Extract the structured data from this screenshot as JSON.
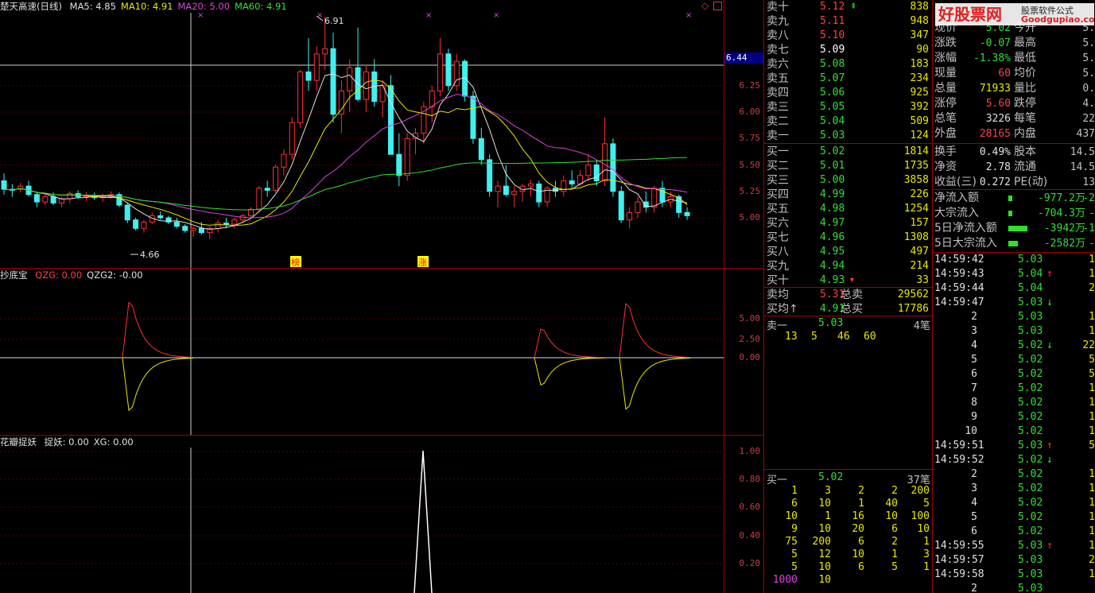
{
  "main_chart": {
    "stock_name": "楚天高速(日线)",
    "ma_labels": [
      {
        "text": "MA5: 4.85",
        "color": "#e0e0e0"
      },
      {
        "text": "MA10: 4.91",
        "color": "#e8e800"
      },
      {
        "text": "MA20: 5.00",
        "color": "#e040e0"
      },
      {
        "text": "MA60: 4.91",
        "color": "#30e030"
      }
    ],
    "crosshair_price": "6.44",
    "high_marker": "6.91",
    "low_marker": "4.66",
    "axis_ticks": [
      "6.25",
      "6.00",
      "5.75",
      "5.50",
      "5.25",
      "5.00"
    ],
    "tags": [
      "榜",
      "涨"
    ]
  },
  "indicator1": {
    "name": "抄底宝",
    "labels": [
      {
        "text": "QZG: 0.00",
        "color": "#ff4040"
      },
      {
        "text": "QZG2: -0.00",
        "color": "#e0e0e0"
      }
    ],
    "axis_ticks": [
      "5.00",
      "2.50",
      "0.00"
    ]
  },
  "indicator2": {
    "name": "花瓣捉妖",
    "labels": [
      {
        "text": "捉妖: 0.00",
        "color": "#e0e0e0"
      },
      {
        "text": "XG: 0.00",
        "color": "#e0e0e0"
      }
    ],
    "axis_ticks": [
      "1.00",
      "0.80",
      "0.60",
      "0.40",
      "0.20"
    ]
  },
  "watermark": {
    "brand": "好股票网",
    "sub": "股票软件公式",
    "url": "Goodgupiao.com"
  },
  "order_book": {
    "asks": [
      {
        "label": "卖十",
        "price": "5.12",
        "volume": "838",
        "color": "#ff4040",
        "mark": "⇞"
      },
      {
        "label": "卖九",
        "price": "5.11",
        "volume": "948",
        "color": "#ff4040",
        "mark": ""
      },
      {
        "label": "卖八",
        "price": "5.10",
        "volume": "347",
        "color": "#ff4040",
        "mark": ""
      },
      {
        "label": "卖七",
        "price": "5.09",
        "volume": "90",
        "color": "#ffffff",
        "mark": ""
      },
      {
        "label": "卖六",
        "price": "5.08",
        "volume": "183",
        "color": "#30e030",
        "mark": ""
      },
      {
        "label": "卖五",
        "price": "5.07",
        "volume": "234",
        "color": "#30e030",
        "mark": ""
      },
      {
        "label": "卖四",
        "price": "5.06",
        "volume": "925",
        "color": "#30e030",
        "mark": ""
      },
      {
        "label": "卖三",
        "price": "5.05",
        "volume": "392",
        "color": "#30e030",
        "mark": ""
      },
      {
        "label": "卖二",
        "price": "5.04",
        "volume": "509",
        "color": "#30e030",
        "mark": ""
      },
      {
        "label": "卖一",
        "price": "5.03",
        "volume": "124",
        "color": "#30e030",
        "mark": ""
      }
    ],
    "bids": [
      {
        "label": "买一",
        "price": "5.02",
        "volume": "1814",
        "color": "#30e030",
        "mark": ""
      },
      {
        "label": "买二",
        "price": "5.01",
        "volume": "1735",
        "color": "#30e030",
        "mark": ""
      },
      {
        "label": "买三",
        "price": "5.00",
        "volume": "3858",
        "color": "#30e030",
        "mark": ""
      },
      {
        "label": "买四",
        "price": "4.99",
        "volume": "226",
        "color": "#30e030",
        "mark": ""
      },
      {
        "label": "买五",
        "price": "4.98",
        "volume": "1254",
        "color": "#30e030",
        "mark": ""
      },
      {
        "label": "买六",
        "price": "4.97",
        "volume": "157",
        "color": "#30e030",
        "mark": ""
      },
      {
        "label": "买七",
        "price": "4.96",
        "volume": "1308",
        "color": "#30e030",
        "mark": ""
      },
      {
        "label": "买八",
        "price": "4.95",
        "volume": "497",
        "color": "#30e030",
        "mark": ""
      },
      {
        "label": "买九",
        "price": "4.94",
        "volume": "214",
        "color": "#30e030",
        "mark": ""
      },
      {
        "label": "买十",
        "price": "4.93",
        "volume": "33",
        "color": "#30e030",
        "mark": "▾"
      }
    ],
    "summary": [
      {
        "label": "卖均",
        "price": "5.31",
        "price_color": "#ff4040",
        "label2": "总卖",
        "value": "29562"
      },
      {
        "label": "买均↑",
        "price": "4.91",
        "price_color": "#30e030",
        "label2": "总买",
        "value": "17786"
      }
    ],
    "sell1_queue": {
      "label": "卖一",
      "price": "5.03",
      "count": "4笔",
      "orders": [
        "13",
        "5",
        "46",
        "60"
      ]
    },
    "buy1_queue": {
      "label": "买一",
      "price": "5.02",
      "count": "37笔",
      "rows": [
        [
          "1",
          "3",
          "2",
          "2",
          "200"
        ],
        [
          "6",
          "10",
          "1",
          "40",
          "5"
        ],
        [
          "10",
          "1",
          "16",
          "10",
          "100"
        ],
        [
          "9",
          "10",
          "20",
          "6",
          "10"
        ],
        [
          "75",
          "200",
          "6",
          "2",
          "1"
        ],
        [
          "5",
          "12",
          "10",
          "1",
          "3"
        ],
        [
          "5",
          "10",
          "6",
          "5",
          "1"
        ],
        [
          "1000",
          "10",
          "",
          "",
          ""
        ]
      ]
    }
  },
  "quote": [
    {
      "l1": "现价",
      "v1": "5.02",
      "c1": "#30e030",
      "l2": "今开",
      "v2": "5."
    },
    {
      "l1": "涨跌",
      "v1": "-0.07",
      "c1": "#30e030",
      "l2": "最高",
      "v2": "5."
    },
    {
      "l1": "涨幅",
      "v1": "-1.38%",
      "c1": "#30e030",
      "l2": "最低",
      "v2": "5."
    },
    {
      "l1": "现量",
      "v1": "60",
      "c1": "#ff4040",
      "l2": "均价",
      "v2": "5."
    },
    {
      "l1": "总量",
      "v1": "71933",
      "c1": "#e8e800",
      "l2": "量比",
      "v2": "0."
    },
    {
      "l1": "涨停",
      "v1": "5.60",
      "c1": "#ff4040",
      "l2": "跌停",
      "v2": "4."
    },
    {
      "l1": "总笔",
      "v1": "3226",
      "c1": "#e0e0e0",
      "l2": "每笔",
      "v2": "22"
    },
    {
      "l1": "外盘",
      "v1": "28165",
      "c1": "#ff4040",
      "l2": "内盘",
      "v2": "437"
    },
    {
      "l1": "换手",
      "v1": "0.49%",
      "c1": "#e0e0e0",
      "l2": "股本",
      "v2": "14.5"
    },
    {
      "l1": "净资",
      "v1": "2.78",
      "c1": "#e0e0e0",
      "l2": "流通",
      "v2": "14.5"
    },
    {
      "l1": "收益(三)",
      "v1": "0.272",
      "c1": "#e0e0e0",
      "l2": "PE(动)",
      "v2": "13"
    }
  ],
  "flows": [
    {
      "label": "净流入额",
      "value": "-977.2万",
      "tail": "-2"
    },
    {
      "label": "大宗流入",
      "value": "-704.3万",
      "tail": "-"
    },
    {
      "label": "5日净流入额",
      "value": "-3942万",
      "tail": "-1"
    },
    {
      "label": "5日大宗流入",
      "value": "-2582万",
      "tail": "-"
    }
  ],
  "ticks": [
    {
      "time": "14:59:42",
      "price": "5.03",
      "arrow": "",
      "vol": "1"
    },
    {
      "time": "14:59:43",
      "price": "5.04",
      "arrow": "↑",
      "vol": "1"
    },
    {
      "time": "14:59:44",
      "price": "5.04",
      "arrow": "",
      "vol": "2"
    },
    {
      "time": "14:59:47",
      "price": "5.03",
      "arrow": "↓",
      "vol": ""
    },
    {
      "time": "2",
      "price": "5.03",
      "arrow": "",
      "vol": "1"
    },
    {
      "time": "3",
      "price": "5.03",
      "arrow": "",
      "vol": "1"
    },
    {
      "time": "4",
      "price": "5.02",
      "arrow": "↓",
      "vol": "22"
    },
    {
      "time": "5",
      "price": "5.02",
      "arrow": "",
      "vol": "5"
    },
    {
      "time": "6",
      "price": "5.02",
      "arrow": "",
      "vol": "5"
    },
    {
      "time": "7",
      "price": "5.02",
      "arrow": "",
      "vol": "1"
    },
    {
      "time": "8",
      "price": "5.02",
      "arrow": "",
      "vol": "1"
    },
    {
      "time": "9",
      "price": "5.02",
      "arrow": "",
      "vol": "1"
    },
    {
      "time": "10",
      "price": "5.02",
      "arrow": "",
      "vol": "1"
    },
    {
      "time": "14:59:51",
      "price": "5.03",
      "arrow": "↑",
      "vol": "5"
    },
    {
      "time": "14:59:52",
      "price": "5.02",
      "arrow": "↓",
      "vol": ""
    },
    {
      "time": "2",
      "price": "5.02",
      "arrow": "",
      "vol": "1"
    },
    {
      "time": "3",
      "price": "5.02",
      "arrow": "",
      "vol": "1"
    },
    {
      "time": "4",
      "price": "5.02",
      "arrow": "",
      "vol": "1"
    },
    {
      "time": "5",
      "price": "5.02",
      "arrow": "",
      "vol": "1"
    },
    {
      "time": "6",
      "price": "5.02",
      "arrow": "",
      "vol": "1"
    },
    {
      "time": "14:59:55",
      "price": "5.03",
      "arrow": "↑",
      "vol": "1"
    },
    {
      "time": "14:59:57",
      "price": "5.03",
      "arrow": "",
      "vol": "2"
    },
    {
      "time": "14:59:58",
      "price": "5.03",
      "arrow": "",
      "vol": "1"
    },
    {
      "time": "2",
      "price": "5.03",
      "arrow": "",
      "vol": ""
    }
  ]
}
